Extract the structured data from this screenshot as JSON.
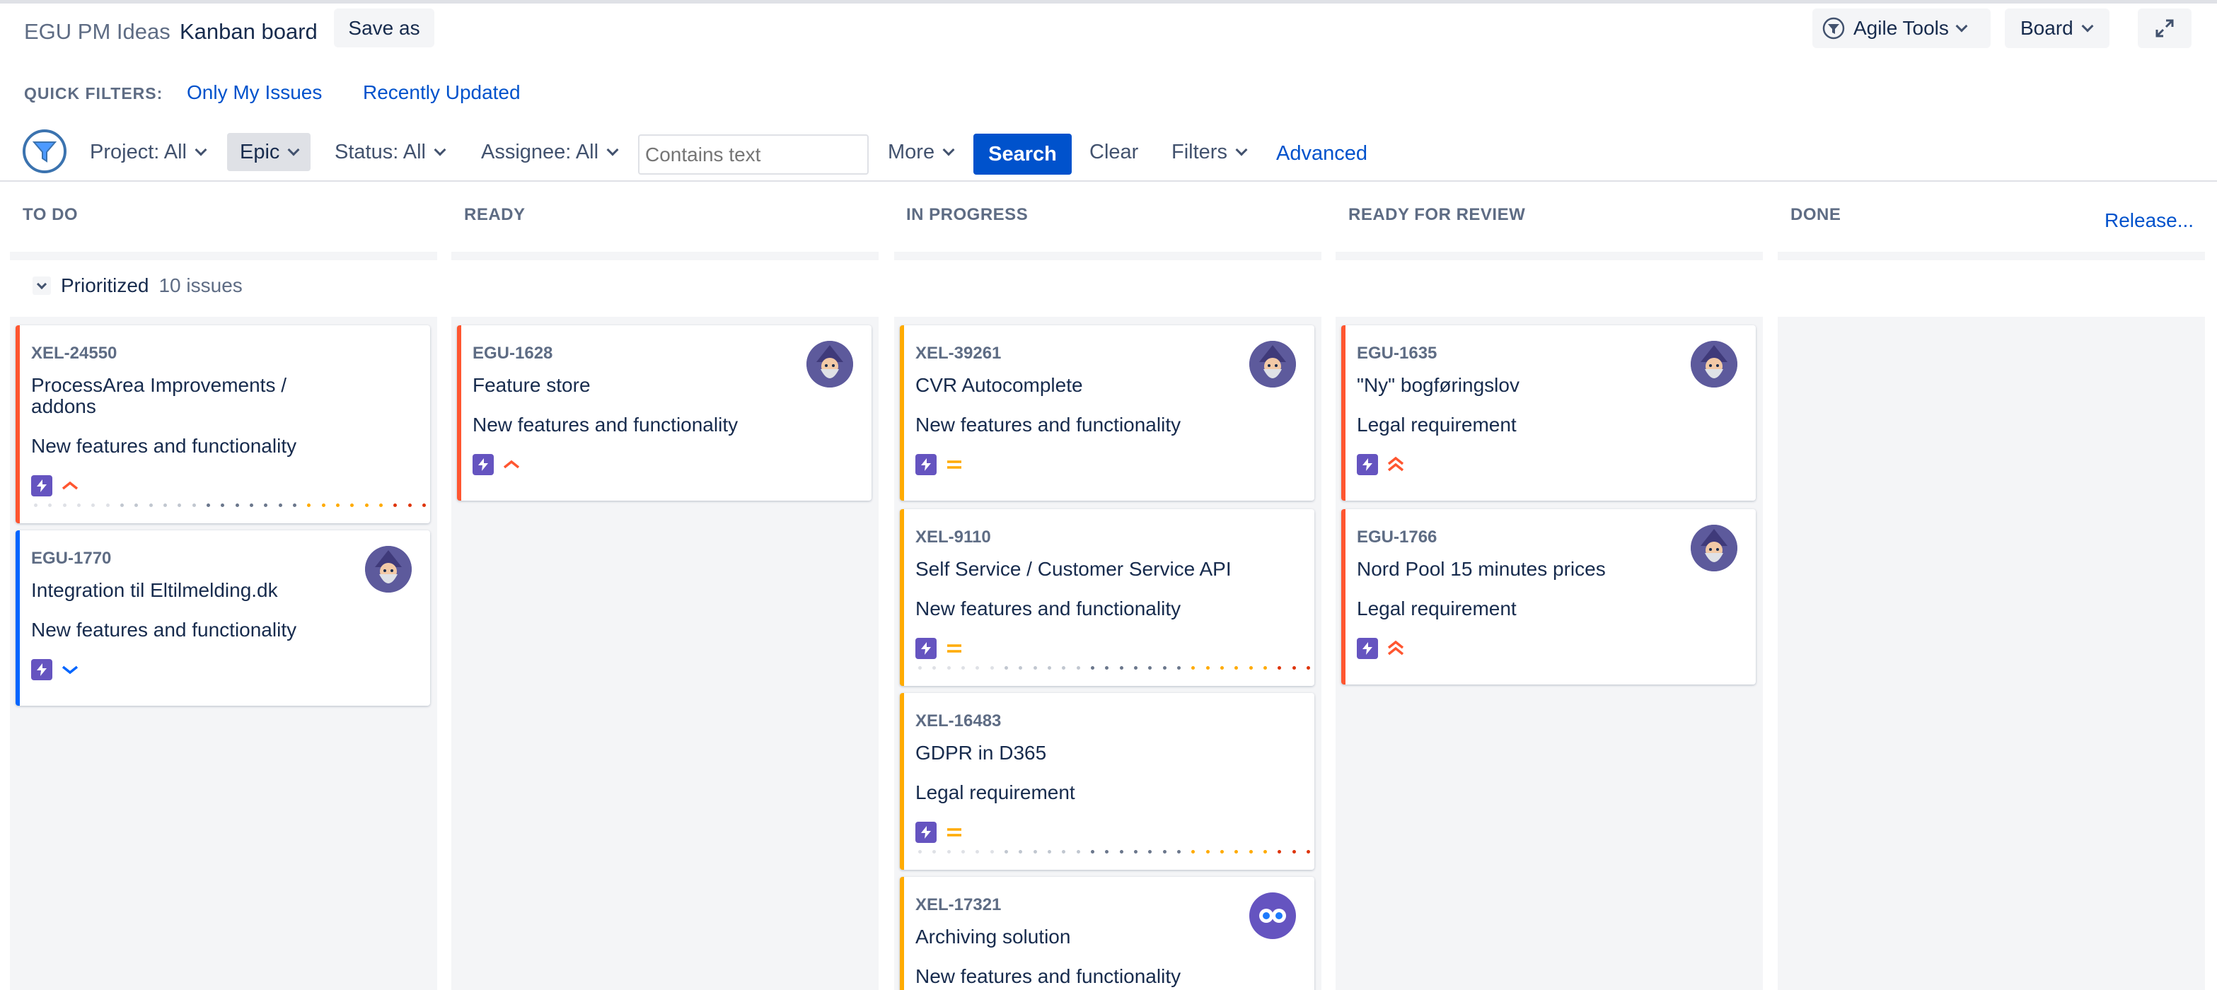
{
  "header": {
    "project": "EGU PM Ideas",
    "board_title": "Kanban board",
    "save_as": "Save as",
    "agile_tools": "Agile Tools",
    "board": "Board"
  },
  "quick_filters": {
    "label": "QUICK FILTERS:",
    "items": [
      "Only My Issues",
      "Recently Updated"
    ]
  },
  "filter_bar": {
    "project": "Project: All",
    "epic": "Epic",
    "status": "Status: All",
    "assignee": "Assignee: All",
    "search_placeholder": "Contains text",
    "more": "More",
    "search": "Search",
    "clear": "Clear",
    "filters": "Filters",
    "advanced": "Advanced"
  },
  "columns": [
    "TO DO",
    "READY",
    "IN PROGRESS",
    "READY FOR REVIEW",
    "DONE"
  ],
  "release_link": "Release...",
  "swimlane": {
    "name": "Prioritized",
    "count": "10 issues"
  },
  "colors": {
    "priority_high": "#ff5630",
    "priority_medium": "#ffab00",
    "priority_low": "#0065ff",
    "epic": "#6554c0",
    "link": "#0052cc"
  },
  "cards": [
    {
      "key": "XEL-24550",
      "summary": "ProcessArea Improvements / addons",
      "epic": "New features and functionality",
      "priority": "high-icon",
      "avatar": false
    },
    {
      "key": "EGU-1770",
      "summary": "Integration til Eltilmelding.dk",
      "epic": "New features and functionality",
      "priority": "low-icon",
      "avatar": true
    },
    {
      "key": "EGU-1628",
      "summary": "Feature store",
      "epic": "New features and functionality",
      "priority": "high-icon",
      "avatar": true
    },
    {
      "key": "XEL-39261",
      "summary": "CVR Autocomplete",
      "epic": "New features and functionality",
      "priority": "medium-icon",
      "avatar": true
    },
    {
      "key": "XEL-9110",
      "summary": "Self Service / Customer Service API",
      "epic": "New features and functionality",
      "priority": "medium-icon",
      "avatar": false
    },
    {
      "key": "XEL-16483",
      "summary": "GDPR in D365",
      "epic": "Legal requirement",
      "priority": "medium-icon",
      "avatar": false
    },
    {
      "key": "XEL-17321",
      "summary": "Archiving solution",
      "epic": "New features and functionality",
      "priority": "medium-icon",
      "avatar": true
    },
    {
      "key": "EGU-1635",
      "summary": "\"Ny\" bogføringslov",
      "epic": "Legal requirement",
      "priority": "highest-icon",
      "avatar": true
    },
    {
      "key": "EGU-1766",
      "summary": "Nord Pool 15 minutes prices",
      "epic": "Legal requirement",
      "priority": "highest-icon",
      "avatar": true
    }
  ]
}
